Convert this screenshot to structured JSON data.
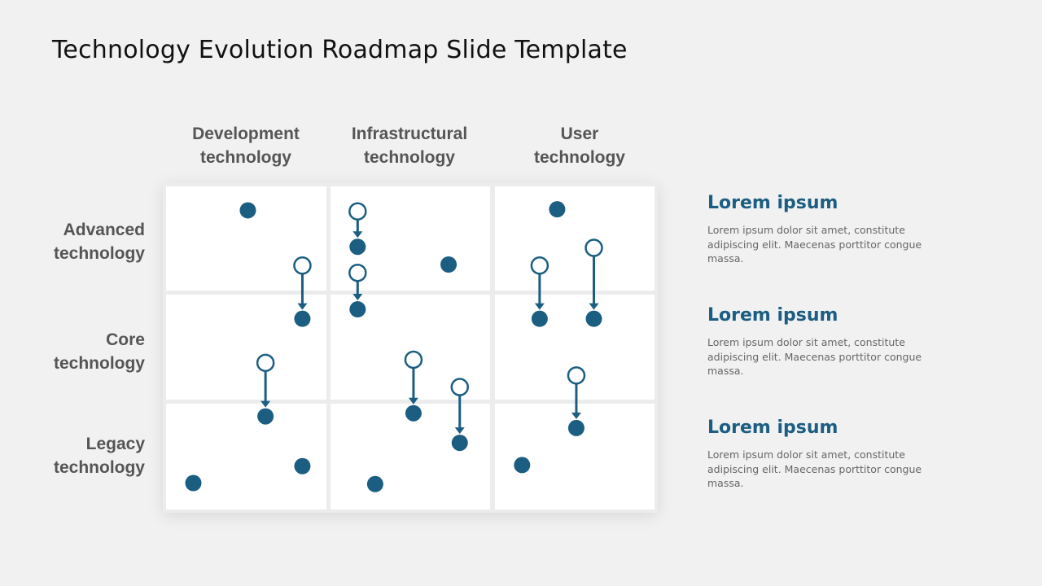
{
  "title": "Technology Evolution Roadmap Slide Template",
  "columns": [
    "Development technology",
    "Infrastructural technology",
    "User technology"
  ],
  "column_lines": [
    [
      "Development",
      "technology"
    ],
    [
      "Infrastructural",
      "technology"
    ],
    [
      "User",
      "technology"
    ]
  ],
  "rows": [
    "Advanced technology",
    "Core technology",
    "Legacy technology"
  ],
  "row_lines": [
    [
      "Advanced",
      "technology"
    ],
    [
      "Core",
      "technology"
    ],
    [
      "Legacy",
      "technology"
    ]
  ],
  "colors": {
    "accent": "#1b5e82",
    "background": "#f1f1f1",
    "cell": "#ffffff",
    "label": "#555555"
  },
  "diagram": {
    "type": "roadmap-grid",
    "note": "Points positioned by fractional location within each cell (cx, cy from 0-1 within column/row band)",
    "static_points": [
      {
        "column": 0,
        "row": 0,
        "fx": 0.51,
        "fy": 0.23
      },
      {
        "column": 1,
        "row": 0,
        "fx": 0.74,
        "fy": 0.75
      },
      {
        "column": 2,
        "row": 0,
        "fx": 0.39,
        "fy": 0.22
      },
      {
        "column": 0,
        "row": 2,
        "fx": 0.17,
        "fy": 0.75
      },
      {
        "column": 0,
        "row": 2,
        "fx": 0.85,
        "fy": 0.59
      },
      {
        "column": 1,
        "row": 2,
        "fx": 0.28,
        "fy": 0.76
      },
      {
        "column": 2,
        "row": 2,
        "fx": 0.17,
        "fy": 0.58
      }
    ],
    "transitions": [
      {
        "column": 0,
        "from": {
          "row": 0,
          "fx": 0.85,
          "fy": 0.76
        },
        "to": {
          "row": 1,
          "fx": 0.85,
          "fy": 0.23
        }
      },
      {
        "column": 1,
        "from": {
          "row": 0,
          "fx": 0.17,
          "fy": 0.24
        },
        "to": {
          "row": 0,
          "fx": 0.17,
          "fy": 0.58
        }
      },
      {
        "column": 1,
        "from": {
          "row": 0,
          "fx": 0.17,
          "fy": 0.83
        },
        "to": {
          "row": 1,
          "fx": 0.17,
          "fy": 0.14
        }
      },
      {
        "column": 2,
        "from": {
          "row": 0,
          "fx": 0.28,
          "fy": 0.76
        },
        "to": {
          "row": 1,
          "fx": 0.28,
          "fy": 0.23
        }
      },
      {
        "column": 2,
        "from": {
          "row": 0,
          "fx": 0.62,
          "fy": 0.59
        },
        "to": {
          "row": 1,
          "fx": 0.62,
          "fy": 0.23
        }
      },
      {
        "column": 0,
        "from": {
          "row": 1,
          "fx": 0.62,
          "fy": 0.65
        },
        "to": {
          "row": 2,
          "fx": 0.62,
          "fy": 0.12
        }
      },
      {
        "column": 1,
        "from": {
          "row": 1,
          "fx": 0.52,
          "fy": 0.62
        },
        "to": {
          "row": 2,
          "fx": 0.52,
          "fy": 0.09
        }
      },
      {
        "column": 1,
        "from": {
          "row": 1,
          "fx": 0.81,
          "fy": 0.88
        },
        "to": {
          "row": 2,
          "fx": 0.81,
          "fy": 0.37
        }
      },
      {
        "column": 2,
        "from": {
          "row": 1,
          "fx": 0.51,
          "fy": 0.77
        },
        "to": {
          "row": 2,
          "fx": 0.51,
          "fy": 0.23
        }
      }
    ]
  },
  "side_panel": [
    {
      "heading": "Lorem ipsum",
      "body": "Lorem ipsum dolor sit amet, constitute adipiscing elit. Maecenas porttitor congue massa."
    },
    {
      "heading": "Lorem ipsum",
      "body": "Lorem ipsum dolor sit amet, constitute adipiscing elit. Maecenas porttitor congue massa."
    },
    {
      "heading": "Lorem ipsum",
      "body": "Lorem ipsum dolor sit amet, constitute adipiscing elit. Maecenas porttitor congue massa."
    }
  ]
}
